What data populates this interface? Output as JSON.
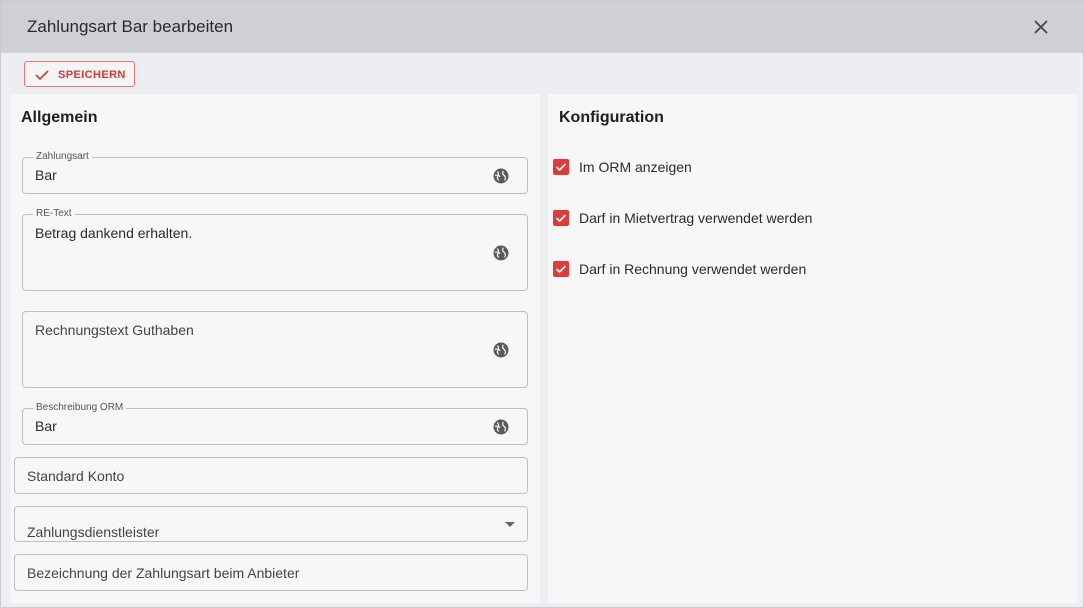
{
  "dialog": {
    "title": "Zahlungsart Bar bearbeiten"
  },
  "toolbar": {
    "save_label": "SPEICHERN"
  },
  "general": {
    "heading": "Allgemein",
    "zahlungsart": {
      "label": "Zahlungsart",
      "value": "Bar"
    },
    "re_text": {
      "label": "RE-Text",
      "value": "Betrag dankend erhalten."
    },
    "rechnungstext_guthaben": {
      "placeholder": "Rechnungstext Guthaben"
    },
    "beschreibung_orm": {
      "label": "Beschreibung ORM",
      "value": "Bar"
    },
    "standard_konto": {
      "placeholder": "Standard Konto"
    },
    "zahlungsdienstleister": {
      "placeholder": "Zahlungsdienstleister"
    },
    "bezeichnung_anbieter": {
      "placeholder": "Bezeichnung der Zahlungsart beim Anbieter"
    }
  },
  "config": {
    "heading": "Konfiguration",
    "options": [
      {
        "label": "Im ORM anzeigen",
        "checked": true
      },
      {
        "label": "Darf in Mietvertrag verwendet werden",
        "checked": true
      },
      {
        "label": "Darf in Rechnung verwendet werden",
        "checked": true
      }
    ]
  },
  "colors": {
    "accent": "#e03a3a",
    "titlebar": "#cfd0d4"
  }
}
